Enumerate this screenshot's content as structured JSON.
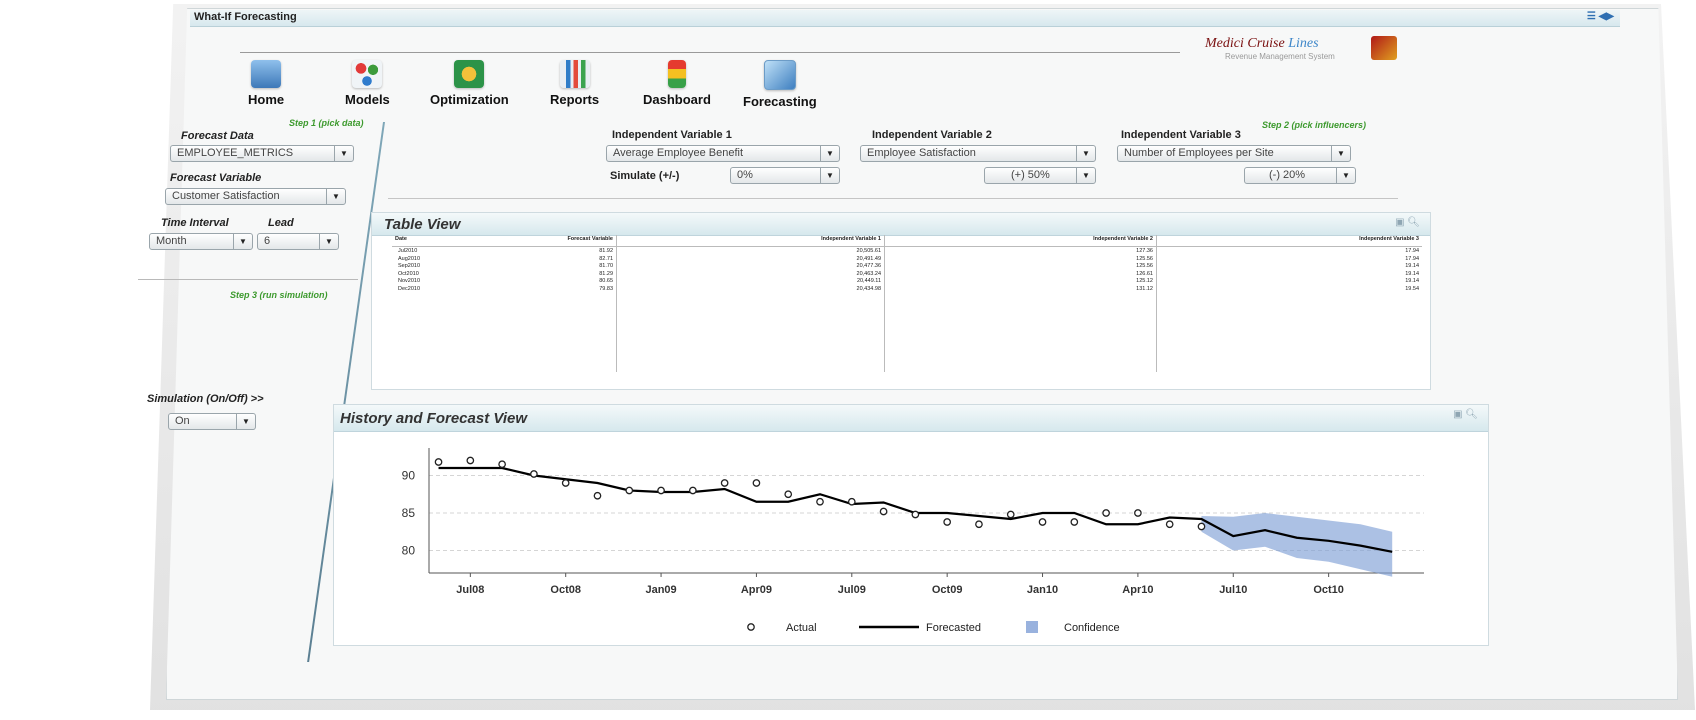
{
  "window": {
    "title": "What-If Forecasting",
    "corner_icons": "☰ ◀▶"
  },
  "logo": {
    "brand_a": "Medici Cruise ",
    "brand_b": "Lines",
    "subtitle": "Revenue Management System"
  },
  "nav": [
    {
      "label": "Home",
      "icon": "home-icon",
      "color": "#4a86c5"
    },
    {
      "label": "Models",
      "icon": "models-icon",
      "color": "#3aa3c9"
    },
    {
      "label": "Optimization",
      "icon": "optimization-icon",
      "color": "#2d9b46"
    },
    {
      "label": "Reports",
      "icon": "reports-icon",
      "color": "#5aa0d6"
    },
    {
      "label": "Dashboard",
      "icon": "dashboard-icon",
      "color": "#e0a020"
    },
    {
      "label": "Forecasting",
      "icon": "forecasting-icon",
      "color": "#3e7fc0"
    }
  ],
  "left": {
    "step1": "Step 1 (pick data)",
    "forecast_data_label": "Forecast Data",
    "forecast_data_value": "EMPLOYEE_METRICS",
    "forecast_variable_label": "Forecast Variable",
    "forecast_variable_value": "Customer Satisfaction",
    "time_interval_label": "Time Interval",
    "time_interval_value": "Month",
    "lead_label": "Lead",
    "lead_value": "6",
    "step3": "Step 3 (run simulation)",
    "simulation_label": "Simulation (On/Off) >>",
    "simulation_value": "On"
  },
  "influencers": {
    "step2": "Step 2 (pick influencers)",
    "iv1_label": "Independent Variable 1",
    "iv1_value": "Average Employee Benefit",
    "iv2_label": "Independent Variable 2",
    "iv2_value": "Employee Satisfaction",
    "iv3_label": "Independent Variable 3",
    "iv3_value": "Number of Employees per Site",
    "simulate_label": "Simulate (+/-)",
    "sim1_value": "0%",
    "sim2_value": "(+) 50%",
    "sim3_value": "(-) 20%"
  },
  "table": {
    "title": "Table View",
    "columns": [
      "Date",
      "Forecast Variable",
      "Independent Variable 1",
      "Independent Variable 2",
      "Independent Variable 3"
    ],
    "rows": [
      [
        "Jul2010",
        "81.92",
        "20,505.61",
        "127.36",
        "17.94"
      ],
      [
        "Aug2010",
        "82.71",
        "20,491.49",
        "125.56",
        "17.94"
      ],
      [
        "Sep2010",
        "81.70",
        "20,477.36",
        "125.56",
        "19.14"
      ],
      [
        "Oct2010",
        "81.29",
        "20,463.24",
        "126.61",
        "19.14"
      ],
      [
        "Nov2010",
        "80.65",
        "20,449.11",
        "125.12",
        "19.14"
      ],
      [
        "Dec2010",
        "79.83",
        "20,434.98",
        "131.12",
        "19.54"
      ]
    ]
  },
  "chart_panel": {
    "title": "History and Forecast View"
  },
  "chart_data": {
    "type": "line",
    "title": "",
    "ylim": [
      77,
      93
    ],
    "yticks": [
      80,
      85,
      90
    ],
    "x_tick_labels": [
      "Jul08",
      "Oct08",
      "Jan09",
      "Apr09",
      "Jul09",
      "Oct09",
      "Jan10",
      "Apr10",
      "Jul10",
      "Oct10"
    ],
    "x_tick_index": [
      1,
      4,
      7,
      10,
      13,
      16,
      19,
      22,
      25,
      28
    ],
    "series": [
      {
        "name": "Actual",
        "style": "circle-markers",
        "x": [
          0,
          1,
          2,
          3,
          4,
          5,
          6,
          7,
          8,
          9,
          10,
          11,
          12,
          13,
          14,
          15,
          16,
          17,
          18,
          19,
          20,
          21,
          22,
          23,
          24
        ],
        "values": [
          91.8,
          92.0,
          91.5,
          90.2,
          89.0,
          87.3,
          88.0,
          88.0,
          88.0,
          89.0,
          89.0,
          87.5,
          86.5,
          86.5,
          85.2,
          84.8,
          83.8,
          83.5,
          84.8,
          83.8,
          83.8,
          85.0,
          85.0,
          83.5,
          83.2
        ]
      },
      {
        "name": "Forecasted",
        "style": "line",
        "x": [
          0,
          1,
          2,
          3,
          4,
          5,
          6,
          7,
          8,
          9,
          10,
          11,
          12,
          13,
          14,
          15,
          16,
          17,
          18,
          19,
          20,
          21,
          22,
          23,
          24,
          25,
          26,
          27,
          28,
          29,
          30
        ],
        "values": [
          91.0,
          91.0,
          91.0,
          90.0,
          89.5,
          89.0,
          88.0,
          87.8,
          87.8,
          88.2,
          86.5,
          86.5,
          87.5,
          86.2,
          86.4,
          85.0,
          85.0,
          84.6,
          84.2,
          85.0,
          85.0,
          83.5,
          83.5,
          84.4,
          84.2,
          81.92,
          82.71,
          81.7,
          81.29,
          80.65,
          79.83
        ]
      },
      {
        "name": "Confidence",
        "style": "band",
        "x": [
          24,
          25,
          26,
          27,
          28,
          29,
          30
        ],
        "lower": [
          82.5,
          80.0,
          80.5,
          79.0,
          78.5,
          77.5,
          76.5
        ],
        "upper": [
          84.6,
          84.5,
          85.0,
          84.5,
          84.0,
          83.5,
          82.5
        ]
      }
    ],
    "legend": [
      "Actual",
      "Forecasted",
      "Confidence"
    ],
    "legend_position": "bottom",
    "colors": {
      "line": "#000000",
      "band": "#7f9fd6",
      "grid": "#d5d5d5"
    },
    "grid": true
  }
}
